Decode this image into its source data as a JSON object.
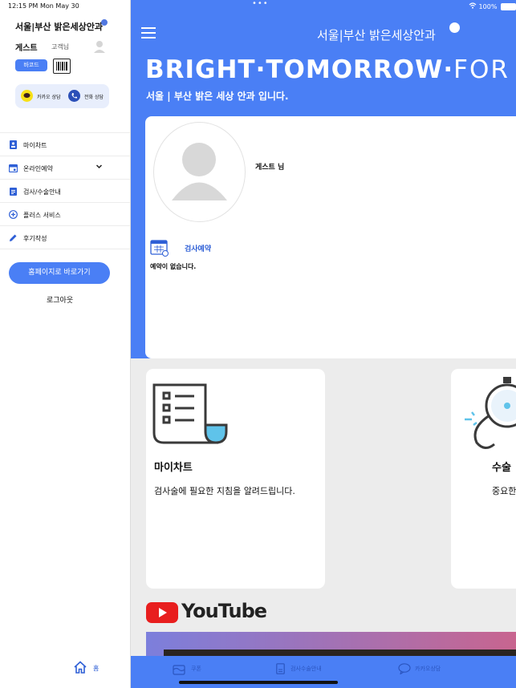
{
  "status_bar": {
    "time": "12:15 PM",
    "date": "Mon May 30",
    "battery": "100%"
  },
  "sidebar": {
    "logo": "서울|부산 밝은세상안과",
    "user_name": "게스트",
    "user_grade": "고객님",
    "barcode_label": "바코드",
    "kakao_consult": "카카오 상담",
    "phone_consult": "전화 상담",
    "menu": [
      {
        "label": "마이차트",
        "icon": "chart-icon"
      },
      {
        "label": "온라인예약",
        "icon": "calendar-icon"
      },
      {
        "label": "검사/수술안내",
        "icon": "clipboard-icon"
      },
      {
        "label": "플러스 서비스",
        "icon": "plus-circle-icon"
      },
      {
        "label": "후기작성",
        "icon": "pencil-icon"
      }
    ],
    "homepage_button": "홈페이지로 바로가기",
    "logout": "로그아웃",
    "home_tab": "홈"
  },
  "main": {
    "logo": "서울|부산 밝은세상안과",
    "headline_bold": "BRIGHT·TOMORROW·",
    "headline_thin": "FOR YO",
    "subtitle": "서울 | 부산 밝은 세상 안과 입니다.",
    "profile": {
      "greeting": "게스트 님",
      "reservation_label": "검사예약",
      "reservation_empty": "예약이 없습니다."
    },
    "cards": [
      {
        "title": "마이차트",
        "desc": "검사술에 필요한 지침을 알려드립니다."
      },
      {
        "title": "수술",
        "desc": "중요한"
      }
    ],
    "youtube_label": "YouTube"
  },
  "tabbar": {
    "items": [
      {
        "label": "쿠폰",
        "icon": "coupon-icon"
      },
      {
        "label": "검사수술안내",
        "icon": "guide-icon"
      },
      {
        "label": "카카오상담",
        "icon": "chat-icon"
      }
    ]
  },
  "colors": {
    "brand_blue": "#4a7ff5",
    "background": "#ececec",
    "text": "#111111"
  }
}
